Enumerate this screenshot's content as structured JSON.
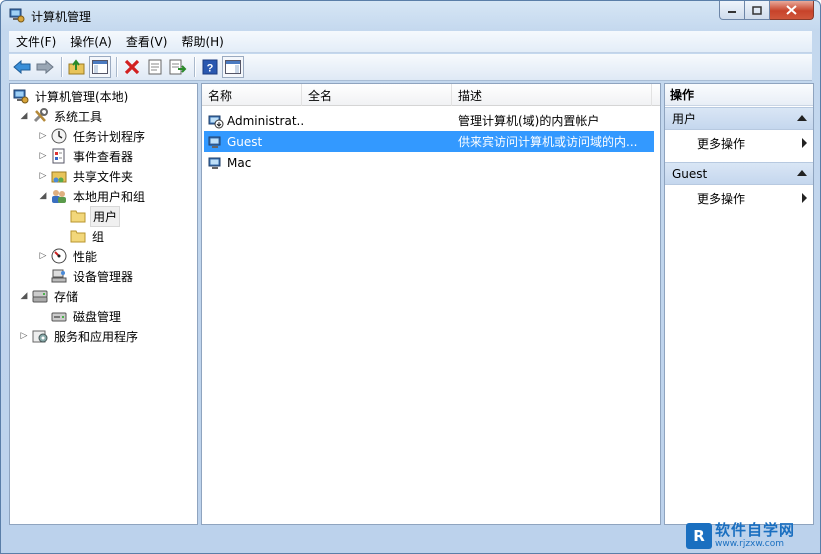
{
  "window": {
    "title": "计算机管理"
  },
  "menu": [
    "文件(F)",
    "操作(A)",
    "查看(V)",
    "帮助(H)"
  ],
  "toolbar": [
    "back-icon",
    "forward-icon",
    "up-folder-icon",
    "show-hide-tree-icon",
    "delete-icon",
    "properties-icon",
    "export-list-icon",
    "help-icon",
    "show-hide-action-pane-icon"
  ],
  "tree": {
    "root": "计算机管理(本地)",
    "system_tools": "系统工具",
    "task_scheduler": "任务计划程序",
    "event_viewer": "事件查看器",
    "shared_folders": "共享文件夹",
    "local_users_groups": "本地用户和组",
    "users": "用户",
    "groups": "组",
    "performance": "性能",
    "device_manager": "设备管理器",
    "storage": "存储",
    "disk_management": "磁盘管理",
    "services_apps": "服务和应用程序"
  },
  "list": {
    "columns": [
      "名称",
      "全名",
      "描述"
    ],
    "rows": [
      {
        "name": "Administrat...",
        "fullname": "",
        "desc": "管理计算机(域)的内置帐户"
      },
      {
        "name": "Guest",
        "fullname": "",
        "desc": "供来宾访问计算机或访问域的内..."
      },
      {
        "name": "Mac",
        "fullname": "",
        "desc": ""
      }
    ],
    "selected_row": "Guest"
  },
  "actions": {
    "header": "操作",
    "group1": "用户",
    "group1_item": "更多操作",
    "group2": "Guest",
    "group2_item": "更多操作"
  },
  "watermark": {
    "logo": "R",
    "title": "软件自学网",
    "url": "www.rjzxw.com"
  }
}
